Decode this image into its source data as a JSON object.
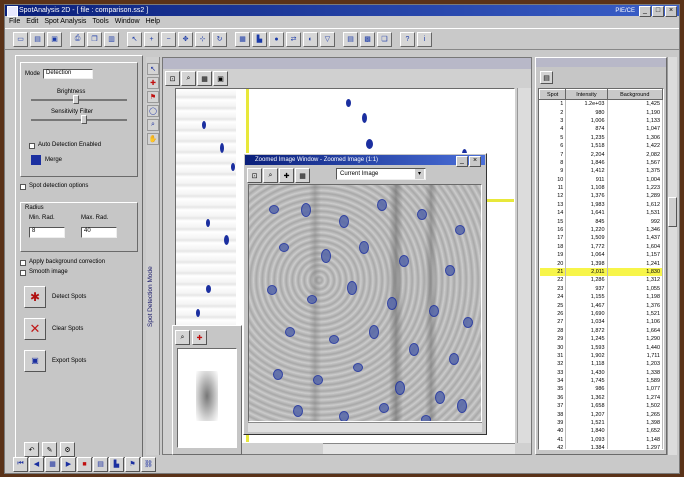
{
  "window": {
    "title": "SpotAnalysis 2D - [ file : comparison.ss2 ]",
    "logo_text": "PIE/CE"
  },
  "menu": [
    "File",
    "Edit",
    "Spot Analysis",
    "Tools",
    "Window",
    "Help"
  ],
  "left_panel": {
    "mode_label": "Mode",
    "mode_value": "Detection",
    "slider1_label": "Brightness",
    "slider2_label": "Sensitivity Filter",
    "auto_check": "Auto Detection Enabled",
    "merge_label": "Merge",
    "section_label": "Spot detection options",
    "group_label": "Radius",
    "field1_label": "Min. Rad.",
    "field1_value": "8",
    "field2_label": "Max. Rad.",
    "field2_value": "40",
    "check1": "Apply background correction",
    "check2": "Smooth image",
    "action1": "Detect Spots",
    "action2": "Clear Spots",
    "action3": "Export Spots"
  },
  "side_tab": "Spot Detection Mode",
  "float_window": {
    "title": "Zoomed Image Window - Zoomed Image (1:1)",
    "dropdown": "Current Image"
  },
  "table": {
    "headers": [
      "Spot",
      "Intensity",
      "Background"
    ],
    "rows": [
      [
        "1",
        "1.2e+03",
        "1,425"
      ],
      [
        "2",
        "980",
        "1,190"
      ],
      [
        "3",
        "1,006",
        "1,133"
      ],
      [
        "4",
        "874",
        "1,047"
      ],
      [
        "5",
        "1,235",
        "1,306"
      ],
      [
        "6",
        "1,518",
        "1,422"
      ],
      [
        "7",
        "2,204",
        "2,082"
      ],
      [
        "8",
        "1,846",
        "1,567"
      ],
      [
        "9",
        "1,412",
        "1,375"
      ],
      [
        "10",
        "911",
        "1,004"
      ],
      [
        "11",
        "1,108",
        "1,223"
      ],
      [
        "12",
        "1,376",
        "1,289"
      ],
      [
        "13",
        "1,983",
        "1,612"
      ],
      [
        "14",
        "1,641",
        "1,531"
      ],
      [
        "15",
        "845",
        "992"
      ],
      [
        "16",
        "1,220",
        "1,346"
      ],
      [
        "17",
        "1,509",
        "1,437"
      ],
      [
        "18",
        "1,772",
        "1,604"
      ],
      [
        "19",
        "1,064",
        "1,157"
      ],
      [
        "20",
        "1,398",
        "1,241"
      ],
      [
        "21",
        "2,011",
        "1,830"
      ],
      [
        "22",
        "1,286",
        "1,312"
      ],
      [
        "23",
        "937",
        "1,055"
      ],
      [
        "24",
        "1,155",
        "1,198"
      ],
      [
        "25",
        "1,467",
        "1,376"
      ],
      [
        "26",
        "1,690",
        "1,521"
      ],
      [
        "27",
        "1,034",
        "1,106"
      ],
      [
        "28",
        "1,872",
        "1,664"
      ],
      [
        "29",
        "1,245",
        "1,290"
      ],
      [
        "30",
        "1,593",
        "1,440"
      ],
      [
        "31",
        "1,902",
        "1,711"
      ],
      [
        "32",
        "1,118",
        "1,203"
      ],
      [
        "33",
        "1,430",
        "1,338"
      ],
      [
        "34",
        "1,745",
        "1,589"
      ],
      [
        "35",
        "986",
        "1,077"
      ],
      [
        "36",
        "1,362",
        "1,274"
      ],
      [
        "37",
        "1,658",
        "1,502"
      ],
      [
        "38",
        "1,207",
        "1,265"
      ],
      [
        "39",
        "1,521",
        "1,398"
      ],
      [
        "40",
        "1,840",
        "1,652"
      ],
      [
        "41",
        "1,093",
        "1,148"
      ],
      [
        "42",
        "1,384",
        "1,297"
      ]
    ],
    "highlight_row": 20
  }
}
